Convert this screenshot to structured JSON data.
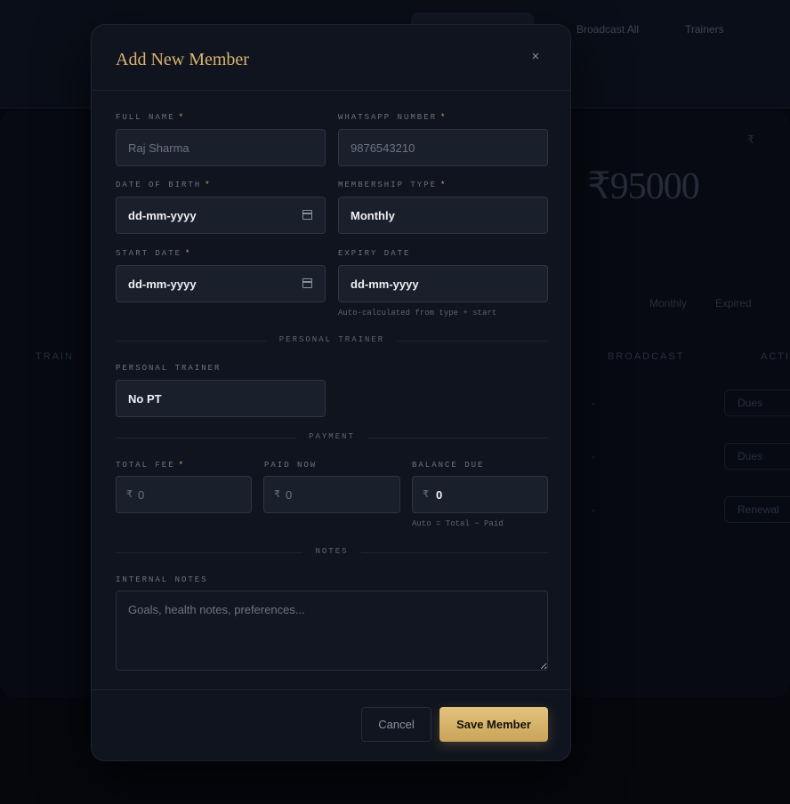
{
  "background": {
    "nav": [
      "Broadcast All",
      "Trainers"
    ],
    "stat_value": "₹95000",
    "rupee_symbol": "₹",
    "columns": [
      "TRAIN",
      "BROADCAST",
      "ACTI"
    ],
    "tabs": [
      "Monthly",
      "Expired"
    ],
    "row_buttons": [
      "Dues",
      "Dues",
      "Renewal"
    ],
    "row_dash": "-"
  },
  "modal": {
    "title": "Add New Member",
    "close_symbol": "×",
    "fields": {
      "full_name": {
        "label": "FULL NAME",
        "required": "*",
        "placeholder": "Raj Sharma"
      },
      "whatsapp": {
        "label": "WHATSAPP NUMBER",
        "required": "*",
        "placeholder": "9876543210"
      },
      "dob": {
        "label": "DATE OF BIRTH",
        "required": "*",
        "value": "dd-mm-yyyy"
      },
      "membership_type": {
        "label": "MEMBERSHIP TYPE",
        "required": "*",
        "value": "Monthly"
      },
      "start_date": {
        "label": "START DATE",
        "required": "*",
        "value": "dd-mm-yyyy"
      },
      "expiry_date": {
        "label": "EXPIRY DATE",
        "value": "dd-mm-yyyy",
        "hint": "Auto-calculated from type + start"
      }
    },
    "sections": {
      "personal_trainer": "PERSONAL TRAINER",
      "payment": "PAYMENT",
      "notes": "NOTES"
    },
    "trainer": {
      "label": "PERSONAL TRAINER",
      "value": "No PT"
    },
    "payment": {
      "currency": "₹",
      "total_fee": {
        "label": "TOTAL FEE",
        "required": "*",
        "placeholder": "0"
      },
      "paid_now": {
        "label": "PAID NOW",
        "placeholder": "0"
      },
      "balance_due": {
        "label": "BALANCE DUE",
        "value": "0",
        "hint": "Auto = Total − Paid"
      }
    },
    "notes": {
      "label": "INTERNAL NOTES",
      "placeholder": "Goals, health notes, preferences..."
    },
    "actions": {
      "cancel": "Cancel",
      "save": "Save Member"
    }
  }
}
